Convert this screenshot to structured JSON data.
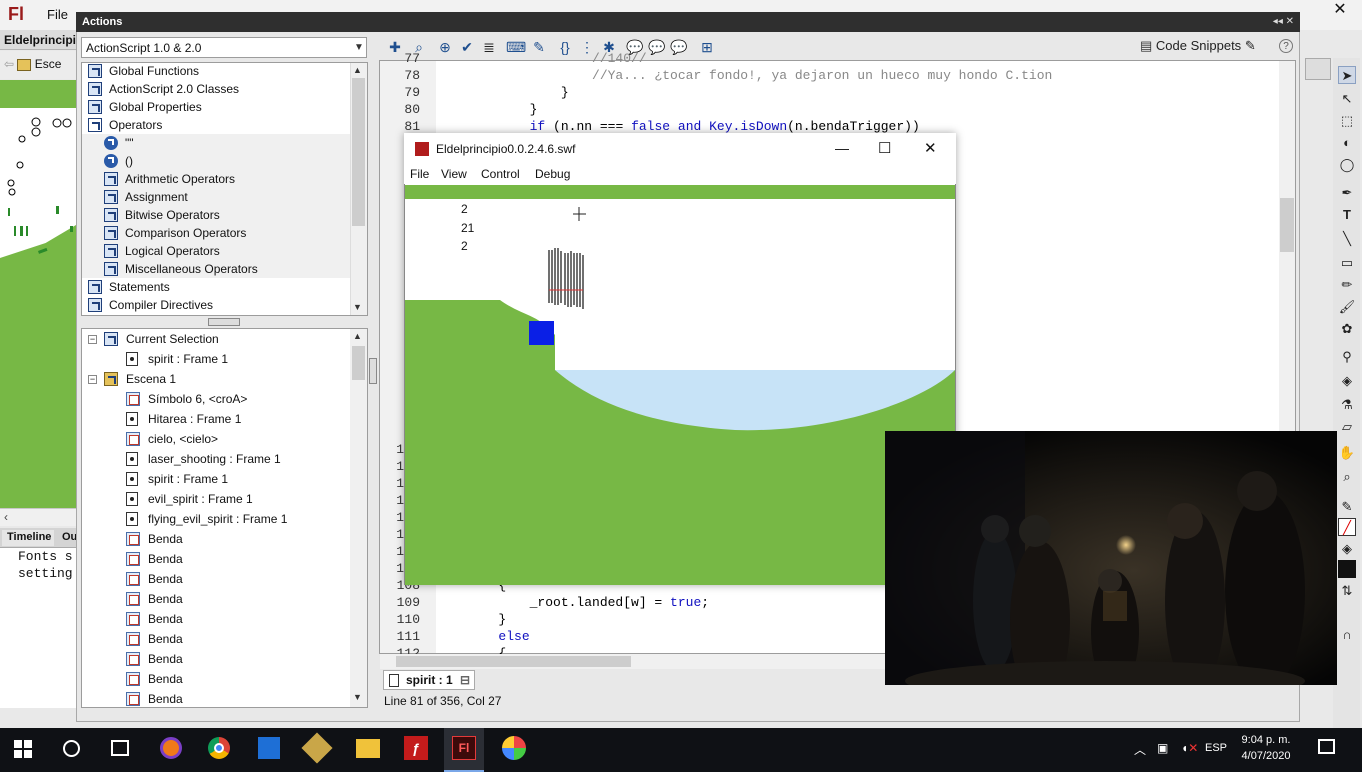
{
  "app": {
    "logo": "Fl",
    "menu_file": "File",
    "close_glyph": "✕",
    "doc_tab": "Eldelprincipi",
    "doc_crumb": "Esce",
    "timeline_tab": "Timeline",
    "output_tab": "Ou",
    "output_lines": "Fonts s\nsetting"
  },
  "actions": {
    "title": "Actions",
    "language": "ActionScript 1.0 & 2.0",
    "snippets_label": "Code Snippets",
    "help": "?",
    "toolbox": [
      {
        "label": "Global Functions",
        "type": "book",
        "indent": 0
      },
      {
        "label": "ActionScript 2.0 Classes",
        "type": "book",
        "indent": 0
      },
      {
        "label": "Global Properties",
        "type": "book",
        "indent": 0
      },
      {
        "label": "Operators",
        "type": "book-open",
        "indent": 0
      },
      {
        "label": "\"\"",
        "type": "circle",
        "indent": 1
      },
      {
        "label": "()",
        "type": "circle",
        "indent": 1
      },
      {
        "label": "Arithmetic Operators",
        "type": "book",
        "indent": 1
      },
      {
        "label": "Assignment",
        "type": "book",
        "indent": 1
      },
      {
        "label": "Bitwise Operators",
        "type": "book",
        "indent": 1
      },
      {
        "label": "Comparison Operators",
        "type": "book",
        "indent": 1
      },
      {
        "label": "Logical Operators",
        "type": "book",
        "indent": 1
      },
      {
        "label": "Miscellaneous Operators",
        "type": "book",
        "indent": 1
      },
      {
        "label": "Statements",
        "type": "book",
        "indent": 0
      },
      {
        "label": "Compiler Directives",
        "type": "book",
        "indent": 0
      }
    ],
    "navigator": [
      {
        "label": "Current Selection",
        "type": "group",
        "expand": "−"
      },
      {
        "label": "spirit : Frame 1",
        "type": "frame",
        "indent": 1
      },
      {
        "label": "Escena 1",
        "type": "scene",
        "expand": "−"
      },
      {
        "label": "Símbolo 6, <croA>",
        "type": "symbol",
        "indent": 1
      },
      {
        "label": "Hitarea : Frame 1",
        "type": "frame",
        "indent": 1
      },
      {
        "label": "cielo, <cielo>",
        "type": "symbol",
        "indent": 1
      },
      {
        "label": "laser_shooting : Frame 1",
        "type": "frame",
        "indent": 1
      },
      {
        "label": "spirit : Frame 1",
        "type": "frame",
        "indent": 1
      },
      {
        "label": "evil_spirit : Frame 1",
        "type": "frame",
        "indent": 1
      },
      {
        "label": "flying_evil_spirit : Frame 1",
        "type": "frame",
        "indent": 1
      },
      {
        "label": "Benda",
        "type": "symbol",
        "indent": 1
      },
      {
        "label": "Benda",
        "type": "symbol",
        "indent": 1
      },
      {
        "label": "Benda",
        "type": "symbol",
        "indent": 1
      },
      {
        "label": "Benda",
        "type": "symbol",
        "indent": 1
      },
      {
        "label": "Benda",
        "type": "symbol",
        "indent": 1
      },
      {
        "label": "Benda",
        "type": "symbol",
        "indent": 1
      },
      {
        "label": "Benda",
        "type": "symbol",
        "indent": 1
      },
      {
        "label": "Benda",
        "type": "symbol",
        "indent": 1
      },
      {
        "label": "Benda",
        "type": "symbol",
        "indent": 1
      }
    ],
    "code_top": [
      {
        "ln": "77",
        "text": "                    //140//",
        "kind": "cm"
      },
      {
        "ln": "78",
        "text": "                    //Ya... ¿tocar fondo!, ya dejaron un hueco muy hondo C.tion",
        "kind": "cm"
      },
      {
        "ln": "79",
        "text": "                }",
        "kind": "plain"
      },
      {
        "ln": "80",
        "text": "            }",
        "kind": "plain"
      },
      {
        "ln": "81",
        "text": "            if (n.nn === false and Key.isDown(n.bendaTrigger))",
        "kind": "mixed"
      }
    ],
    "code_bottom": [
      {
        "ln": "108",
        "text": "        {",
        "kind": "plain"
      },
      {
        "ln": "109",
        "text": "            _root.landed[w] = true;",
        "kind": "plain"
      },
      {
        "ln": "110",
        "text": "        }",
        "kind": "plain"
      },
      {
        "ln": "111",
        "text": "        else",
        "kind": "kw"
      },
      {
        "ln": "112",
        "text": "        {",
        "kind": "plain"
      }
    ],
    "partial_gutter": [
      "1",
      "1",
      "1",
      "1",
      "1",
      "1",
      "1",
      "1"
    ],
    "script_tab": "spirit : 1",
    "status": "Line 81 of 356, Col 27"
  },
  "swf_window": {
    "title": "Eldelprincipio0.0.2.4.6.swf",
    "menu": [
      "File",
      "View",
      "Control",
      "Debug"
    ],
    "minimize": "—",
    "maximize": "☐",
    "close": "✕",
    "debug_values": [
      "2",
      "21",
      "2"
    ],
    "colors": {
      "ground": "#77b845",
      "water": "#c7e3f7",
      "player": "#0a1fe6"
    }
  },
  "taskbar": {
    "language": "ESP",
    "time": "9:04 p. m.",
    "date": "4/07/2020"
  }
}
